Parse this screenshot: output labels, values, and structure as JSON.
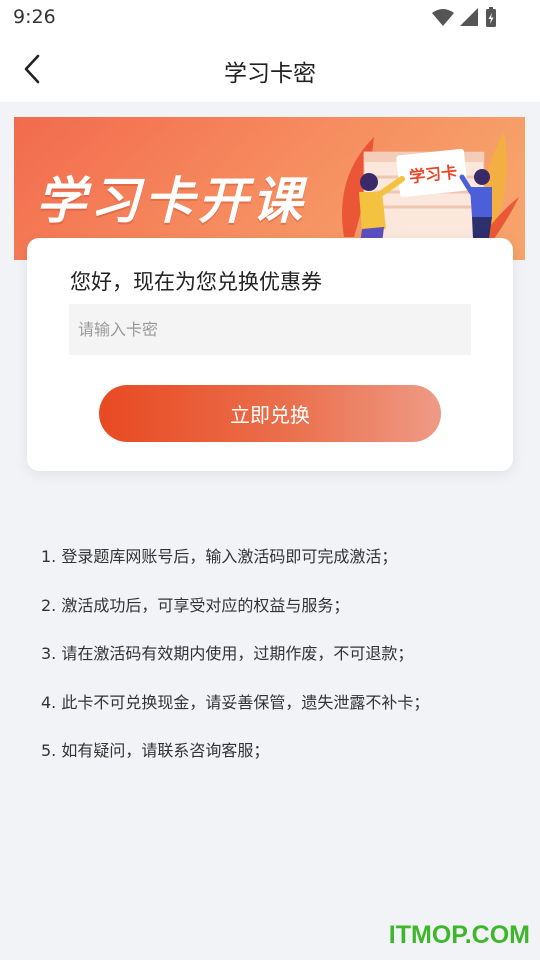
{
  "status_bar": {
    "time": "9:26",
    "icons": [
      "wifi-icon",
      "signal-icon",
      "battery-icon"
    ]
  },
  "navbar": {
    "back_icon": "chevron-left-icon",
    "title": "学习卡密"
  },
  "banner": {
    "headline": "学习卡开课",
    "card_label": "学习卡"
  },
  "redeem_card": {
    "greeting": "您好，现在为您兑换优惠券",
    "input_value": "",
    "input_placeholder": "请输入卡密",
    "button_label": "立即兑换"
  },
  "rules": [
    "1. 登录题库网账号后，输入激活码即可完成激活；",
    "2. 激活成功后，可享受对应的权益与服务；",
    "3. 请在激活码有效期内使用，过期作废，不可退款；",
    "4. 此卡不可兑换现金，请妥善保管，遗失泄露不补卡；",
    "5. 如有疑问，请联系咨询客服；"
  ],
  "watermark": "ITMOP.COM",
  "colors": {
    "accent_start": "#e84a22",
    "accent_end": "#ef9a85",
    "page_bg": "#f2f3f6",
    "watermark": "#3fb72c"
  }
}
